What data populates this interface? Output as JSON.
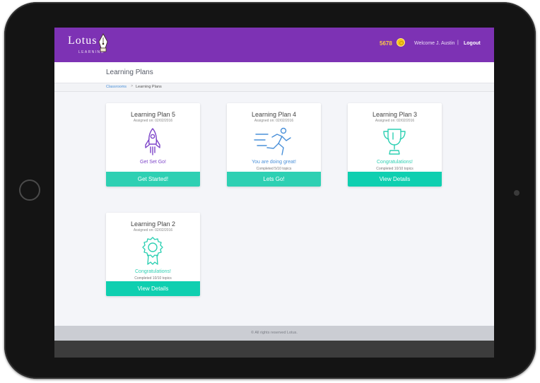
{
  "brand": {
    "name": "Lotus",
    "sub": "LEARNING"
  },
  "header": {
    "coins": "5678",
    "welcome": "Welcome J. Austin",
    "separator": "|",
    "logout": "Logout"
  },
  "page": {
    "title": "Learning Plans"
  },
  "breadcrumb": {
    "home": "Classrooms",
    "separator": ">",
    "current": "Learning Plans"
  },
  "colors": {
    "header": "#7d32b4",
    "accent": "#2ed0b3",
    "in_progress": "#4a90d9",
    "icon_purple": "#7d44c9"
  },
  "cards": [
    {
      "title": "Learning Plan 5",
      "assigned": "Assigned on: 02/02/2016",
      "icon": "rocket-icon",
      "message": "Get Set Go!",
      "progress": "",
      "button": "Get Started!"
    },
    {
      "title": "Learning Plan 4",
      "assigned": "Assigned on: 02/02/2016",
      "icon": "runner-icon",
      "message": "You are doing great!",
      "progress": "Completed 5/10 topics",
      "button": "Lets Go!"
    },
    {
      "title": "Learning Plan 3",
      "assigned": "Assigned on: 02/02/2016",
      "icon": "trophy-icon",
      "message": "Congratulations!",
      "progress": "Completed 10/10 topics",
      "button": "View Details"
    },
    {
      "title": "Learning Plan 2",
      "assigned": "Assigned on: 02/02/2016",
      "icon": "ribbon-badge-icon",
      "message": "Congratulations!",
      "progress": "Completed 10/10 topics",
      "button": "View Details"
    }
  ],
  "footer": {
    "text": "All rights reserved Lotus."
  }
}
